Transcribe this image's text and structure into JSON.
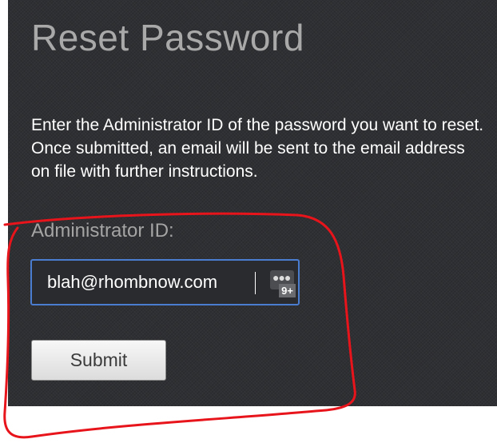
{
  "page": {
    "title": "Reset Password",
    "instructions": "Enter the Administrator ID of the password you want to reset. Once submitted, an email will be sent to the email address on file with further instructions."
  },
  "form": {
    "admin_id_label": "Administrator ID:",
    "admin_id_value": "blah@rhombnow.com",
    "password_manager_icon": "ellipsis-icon",
    "password_manager_badge": "9+",
    "submit_label": "Submit"
  },
  "colors": {
    "panel_background": "#2f3033",
    "title": "#a9a9a9",
    "input_focus_border": "#4a7ccf",
    "annotation_stroke": "#e8141b"
  }
}
